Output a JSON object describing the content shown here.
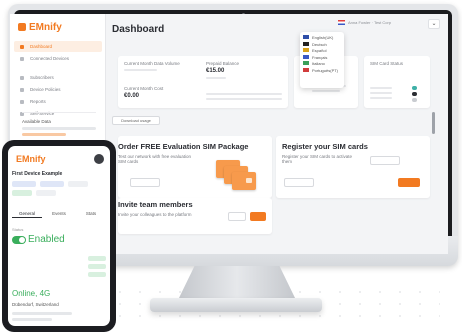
{
  "brand": {
    "name": "EMnify",
    "color": "#f27a21"
  },
  "sidebar": {
    "items": [
      {
        "label": "Dashboard",
        "active": true
      },
      {
        "label": "Connected Devices",
        "active": false
      },
      {
        "label": "Subscribers",
        "active": false
      },
      {
        "label": "Device Policies",
        "active": false
      },
      {
        "label": "Reports",
        "active": false
      },
      {
        "label": "Self-Service",
        "active": false
      }
    ],
    "card_title": "Available Data"
  },
  "topbar": {
    "user_label": "Anna Fowler · Test Corp",
    "language_button": "⌄"
  },
  "language_menu": {
    "items": [
      {
        "label": "English(UK)",
        "color": "#2e4ea8"
      },
      {
        "label": "Deutsch",
        "color": "#222222"
      },
      {
        "label": "Español",
        "color": "#d9a21a"
      },
      {
        "label": "Français",
        "color": "#3b58c4"
      },
      {
        "label": "Italiano",
        "color": "#3aa05a"
      },
      {
        "label": "Português(PT)",
        "color": "#d13c3c"
      }
    ]
  },
  "dashboard": {
    "title": "Dashboard",
    "stats": {
      "current_month_data_label": "Current Month Data Volume",
      "prepaid_balance_label": "Prepaid Balance",
      "prepaid_balance_value": "€15.00",
      "current_month_cost_label": "Current Month Cost",
      "current_month_cost_value": "€0.00",
      "data_traffic_label": "Data Traffic",
      "sim_card_status_label": "SIM Card Status"
    },
    "download_button": "Download usage",
    "order": {
      "title": "Order FREE Evaluation SIM Package",
      "desc": "Test our network with free evaluation SIM cards"
    },
    "register": {
      "title": "Register your SIM cards",
      "desc": "Register your SIM cards to activate them"
    },
    "invite": {
      "title": "Invite team members",
      "desc": "Invite your colleagues to the platform"
    }
  },
  "phone": {
    "brand": "EMnify",
    "device_title": "First Device Example",
    "tabs": [
      "General",
      "Events",
      "Stats"
    ],
    "status_label": "Status",
    "enabled_label": "Enabled",
    "online_label": "Online, 4G",
    "location_label": "Dübendorf, Switzerland",
    "colors": {
      "enabled": "#3aae5c"
    }
  }
}
